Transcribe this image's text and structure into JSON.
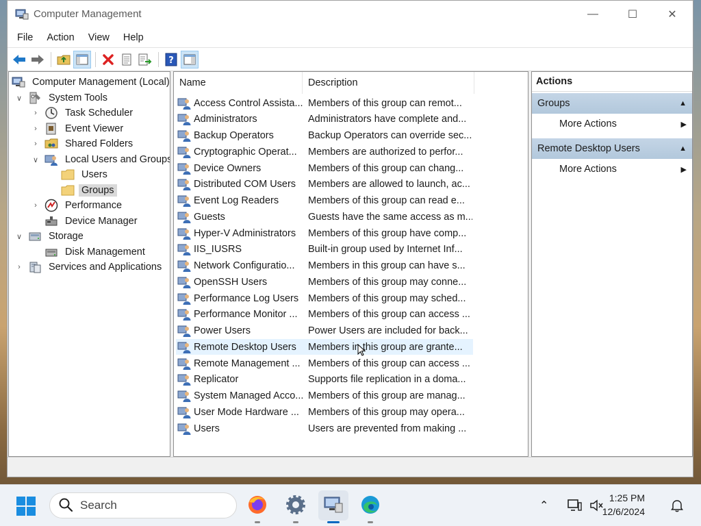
{
  "window": {
    "title": "Computer Management",
    "controls": {
      "minimize": "—",
      "maximize": "☐",
      "close": "✕"
    }
  },
  "menu": [
    "File",
    "Action",
    "View",
    "Help"
  ],
  "toolbar": {
    "buttons": [
      "back-icon",
      "forward-icon",
      "up-folder-icon",
      "show-hide-tree-icon",
      "delete-icon",
      "properties-icon",
      "export-list-icon",
      "help-icon",
      "show-hide-action-pane-icon"
    ]
  },
  "tree": [
    {
      "label": "Computer Management (Local)",
      "icon": "computer-management-icon",
      "level": 0,
      "expander": ""
    },
    {
      "label": "System Tools",
      "icon": "system-tools-icon",
      "level": 1,
      "expander": "open"
    },
    {
      "label": "Task Scheduler",
      "icon": "task-scheduler-icon",
      "level": 2,
      "expander": "closed"
    },
    {
      "label": "Event Viewer",
      "icon": "event-viewer-icon",
      "level": 2,
      "expander": "closed"
    },
    {
      "label": "Shared Folders",
      "icon": "shared-folders-icon",
      "level": 2,
      "expander": "closed"
    },
    {
      "label": "Local Users and Groups",
      "icon": "users-groups-icon",
      "level": 2,
      "expander": "open"
    },
    {
      "label": "Users",
      "icon": "folder-icon",
      "level": 3,
      "expander": ""
    },
    {
      "label": "Groups",
      "icon": "folder-icon",
      "level": 3,
      "expander": "",
      "selected": true
    },
    {
      "label": "Performance",
      "icon": "performance-icon",
      "level": 2,
      "expander": "closed"
    },
    {
      "label": "Device Manager",
      "icon": "device-manager-icon",
      "level": 2,
      "expander": ""
    },
    {
      "label": "Storage",
      "icon": "storage-icon",
      "level": 1,
      "expander": "open"
    },
    {
      "label": "Disk Management",
      "icon": "disk-management-icon",
      "level": 2,
      "expander": ""
    },
    {
      "label": "Services and Applications",
      "icon": "services-apps-icon",
      "level": 1,
      "expander": "closed"
    }
  ],
  "list": {
    "columns": [
      "Name",
      "Description"
    ],
    "rows": [
      {
        "name": "Access Control Assista...",
        "description": "Members of this group can remot..."
      },
      {
        "name": "Administrators",
        "description": "Administrators have complete and..."
      },
      {
        "name": "Backup Operators",
        "description": "Backup Operators can override sec..."
      },
      {
        "name": "Cryptographic Operat...",
        "description": "Members are authorized to perfor..."
      },
      {
        "name": "Device Owners",
        "description": "Members of this group can chang..."
      },
      {
        "name": "Distributed COM Users",
        "description": "Members are allowed to launch, ac..."
      },
      {
        "name": "Event Log Readers",
        "description": "Members of this group can read e..."
      },
      {
        "name": "Guests",
        "description": "Guests have the same access as m..."
      },
      {
        "name": "Hyper-V Administrators",
        "description": "Members of this group have comp..."
      },
      {
        "name": "IIS_IUSRS",
        "description": "Built-in group used by Internet Inf..."
      },
      {
        "name": "Network Configuratio...",
        "description": "Members in this group can have s..."
      },
      {
        "name": "OpenSSH Users",
        "description": "Members of this group may conne..."
      },
      {
        "name": "Performance Log Users",
        "description": "Members of this group may sched..."
      },
      {
        "name": "Performance Monitor ...",
        "description": "Members of this group can access ..."
      },
      {
        "name": "Power Users",
        "description": "Power Users are included for back..."
      },
      {
        "name": "Remote Desktop Users",
        "description": "Members in this group are grante...",
        "hover": true
      },
      {
        "name": "Remote Management ...",
        "description": "Members of this group can access ..."
      },
      {
        "name": "Replicator",
        "description": "Supports file replication in a doma..."
      },
      {
        "name": "System Managed Acco...",
        "description": "Members of this group are manag..."
      },
      {
        "name": "User Mode Hardware ...",
        "description": "Members of this group may opera..."
      },
      {
        "name": "Users",
        "description": "Users are prevented from making ..."
      }
    ]
  },
  "actions": {
    "title": "Actions",
    "sections": [
      {
        "label": "Groups",
        "items": [
          "More Actions"
        ]
      },
      {
        "label": "Remote Desktop Users",
        "items": [
          "More Actions"
        ]
      }
    ]
  },
  "taskbar": {
    "search_label": "Search",
    "apps": [
      "firefox-icon",
      "settings-icon",
      "computer-management-icon",
      "edge-icon"
    ],
    "active_app": "computer-management-icon",
    "time": "1:25 PM",
    "date": "12/6/2024"
  },
  "colors": {
    "selection": "#d9d9d9",
    "hover": "#e5f3ff",
    "action_section": "#b9cde0",
    "accent": "#0067c0"
  }
}
